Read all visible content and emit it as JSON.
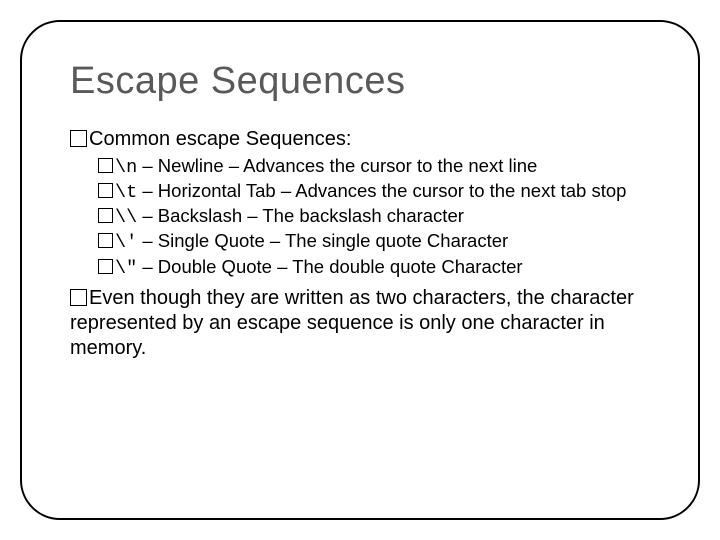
{
  "title": "Escape Sequences",
  "intro": "Common escape Sequences:",
  "items": [
    {
      "code": "\\n",
      "name": "Newline",
      "desc": "Advances the cursor to the next line"
    },
    {
      "code": "\\t",
      "name": "Horizontal Tab",
      "desc": "Advances the cursor to the next tab stop"
    },
    {
      "code": "\\\\",
      "name": "Backslash",
      "desc": "The backslash character"
    },
    {
      "code": "\\'",
      "name": "Single Quote",
      "desc": "The single quote Character"
    },
    {
      "code": "\\\"",
      "name": "Double Quote",
      "desc": "The double quote Character"
    }
  ],
  "outro": "Even though they are written as two characters, the character represented by an escape sequence is only one character in memory."
}
